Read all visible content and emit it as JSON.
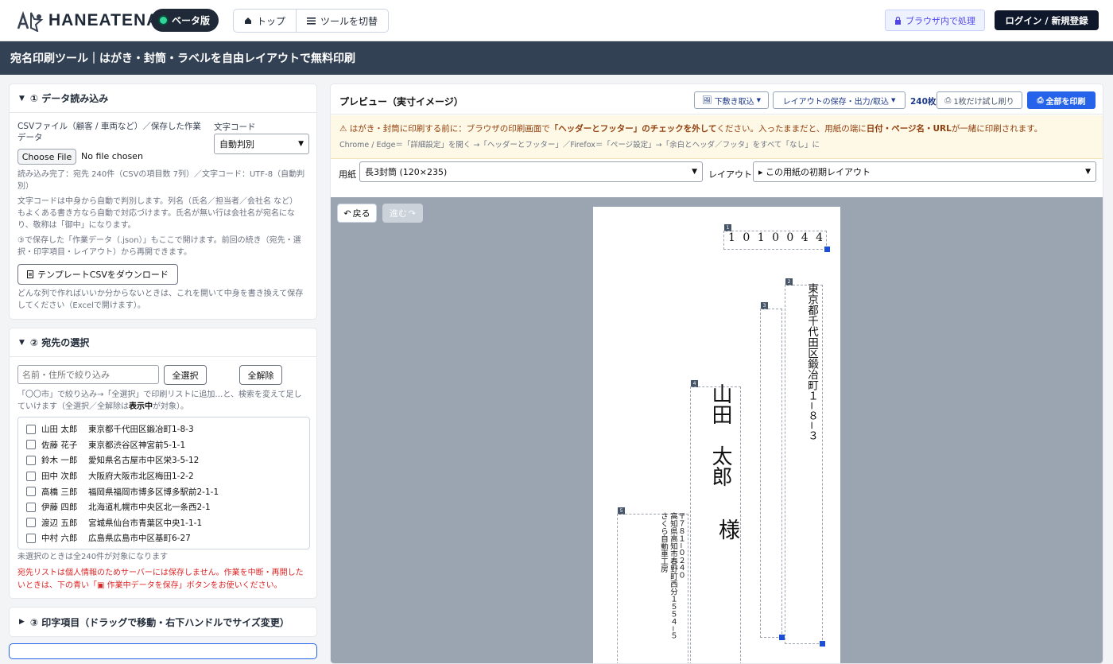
{
  "header": {
    "logo_text": "HANEATENA",
    "beta_label": "ベータ版",
    "nav_top": "トップ",
    "nav_switch": "ツールを切替",
    "browser_badge": "ブラウザ内で処理",
    "login_label": "ログイン / 新規登録"
  },
  "title_bar": "宛名印刷ツール｜はがき・封筒・ラベルを自由レイアウトで無料印刷",
  "section1": {
    "title": "① データ読み込み",
    "csv_label": "CSVファイル（顧客 / 車両など）／保存した作業データ",
    "encoding_label": "文字コード",
    "encoding_value": "自動判別",
    "choose_file": "Choose File",
    "no_file": "No file chosen",
    "status": "読み込み完了：宛先 240件（CSVの項目数 7列）／文字コード：UTF-8（自動判別）",
    "note1": "文字コードは中身から自動で判別します。列名（氏名／担当者／会社名 など）もよくある書き方なら自動で対応づけます。氏名が無い行は会社名が宛名になり、敬称は「御中」になります。",
    "note2": "③で保存した「作業データ（.json）」もここで開けます。前回の続き（宛先・選択・印字項目・レイアウト）から再開できます。",
    "template_button": "テンプレートCSVをダウンロード",
    "template_note": "どんな列で作ればいいか分からないときは、これを開いて中身を書き換えて保存してください（Excelで開けます）。"
  },
  "section2": {
    "title": "② 宛先の選択",
    "filter_placeholder": "名前・住所で絞り込み",
    "select_all": "全選択",
    "clear_all": "全解除",
    "hint_a": "「〇〇市」で絞り込み→「全選択」で印刷リストに追加…と、検索を変えて足していけます（全選択／全解除は",
    "hint_b": "表示中",
    "hint_c": "が対象）。",
    "recipients": [
      {
        "name": "山田 太郎",
        "address": "東京都千代田区鍛冶町1-8-3"
      },
      {
        "name": "佐藤 花子",
        "address": "東京都渋谷区神宮前5-1-1"
      },
      {
        "name": "鈴木 一郎",
        "address": "愛知県名古屋市中区栄3-5-12"
      },
      {
        "name": "田中 次郎",
        "address": "大阪府大阪市北区梅田1-2-2"
      },
      {
        "name": "高橋 三郎",
        "address": "福岡県福岡市博多区博多駅前2-1-1"
      },
      {
        "name": "伊藤 四郎",
        "address": "北海道札幌市中央区北一条西2-1"
      },
      {
        "name": "渡辺 五郎",
        "address": "宮城県仙台市青葉区中央1-1-1"
      },
      {
        "name": "中村 六郎",
        "address": "広島県広島市中区基町6-27"
      }
    ],
    "unselected_note": "未選択のときは全240件が対象になります",
    "privacy_a": "宛先リストは個人情報のためサーバーには保存しません。作業を中断・再開したいときは、下の青い「",
    "privacy_b": "作業中データを保存",
    "privacy_c": "」ボタンをお使いください。"
  },
  "section3": {
    "title": "③ 印字項目（ドラッグで移動・右下ハンドルでサイズ変更）"
  },
  "preview": {
    "title": "プレビュー（実寸イメージ）",
    "draft_button": "下敷き取込",
    "layout_button": "レイアウトの保存・出力/取込",
    "count": "240枚",
    "test_print": "1枚だけ試し刷り",
    "print_all": "全部を印刷",
    "warning_a": "はがき・封筒に印刷する前に：ブラウザの印刷画面で",
    "warning_b": "「ヘッダーとフッター」のチェックを外して",
    "warning_c": "ください。入ったままだと、用紙の端に",
    "warning_d": "日付・ページ名・URL",
    "warning_e": "が一緒に印刷されます。",
    "warning_detail": "Chrome / Edge＝「詳細設定」を開く →「ヘッダーとフッター」／Firefox＝「ページ設定」→「余白とヘッダ／フッタ」をすべて「なし」に",
    "paper_label": "用紙",
    "paper_value": "長3封筒 (120×235)",
    "layout_label": "レイアウト",
    "layout_value": "▸ この用紙の初期レイアウト",
    "back_button": "戻る",
    "next_button": "進む"
  },
  "envelope": {
    "postal": "1 0 1 0 0 4 4",
    "address": "東京都千代田区鍛冶町１−８−３",
    "name": "山田　太郎",
    "honorific": "様",
    "sender_postal": "〒７８１−０２４０",
    "sender_address": "高知県高知市春野町西分１５５４−５",
    "sender_name": "さくら自動車工房",
    "box_numbers": [
      "1",
      "2",
      "3",
      "4",
      "5"
    ]
  },
  "colors": {
    "accent_blue": "#2563eb",
    "title_bar_bg": "#334155",
    "warning_bg": "#fef9e7",
    "preview_bg": "#9aa5b1"
  }
}
